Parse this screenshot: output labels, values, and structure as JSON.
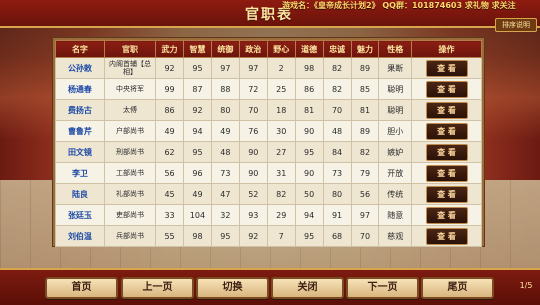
{
  "header": {
    "title": "官职表",
    "notice": "游戏名：《皇帝成长计划2》 QQ群：101874603 求礼物 求关注",
    "rules_label": "排序说明"
  },
  "table": {
    "columns": [
      "名字",
      "官职",
      "武力",
      "智慧",
      "统御",
      "政治",
      "野心",
      "道德",
      "忠诚",
      "魅力",
      "性格",
      "操作"
    ],
    "rows": [
      {
        "name": "公孙敕",
        "post": "内阁首辅【总相】",
        "wuli": "92",
        "zhihui": "95",
        "tongyu": "97",
        "zhengzhi": "97",
        "yexin": "2",
        "daode": "98",
        "zhongcheng": "82",
        "meili": "89",
        "xingge": "果断",
        "action": "查 看"
      },
      {
        "name": "杨通春",
        "post": "中央将军",
        "wuli": "99",
        "zhihui": "87",
        "tongyu": "88",
        "zhengzhi": "72",
        "yexin": "25",
        "daode": "86",
        "zhongcheng": "82",
        "meili": "85",
        "xingge": "聪明",
        "action": "查 看"
      },
      {
        "name": "费扬古",
        "post": "太傅",
        "wuli": "86",
        "zhihui": "92",
        "tongyu": "80",
        "zhengzhi": "70",
        "yexin": "18",
        "daode": "81",
        "zhongcheng": "70",
        "meili": "81",
        "xingge": "聪明",
        "action": "查 看"
      },
      {
        "name": "曹鲁芹",
        "post": "户部尚书",
        "wuli": "49",
        "zhihui": "94",
        "tongyu": "49",
        "zhengzhi": "76",
        "yexin": "30",
        "daode": "90",
        "zhongcheng": "48",
        "meili": "89",
        "xingge": "胆小",
        "action": "查 看"
      },
      {
        "name": "田文镜",
        "post": "刑部尚书",
        "wuli": "62",
        "zhihui": "95",
        "tongyu": "48",
        "zhengzhi": "90",
        "yexin": "27",
        "daode": "95",
        "zhongcheng": "84",
        "meili": "82",
        "xingge": "嫉妒",
        "action": "查 看"
      },
      {
        "name": "李卫",
        "post": "工部尚书",
        "wuli": "56",
        "zhihui": "96",
        "tongyu": "73",
        "zhengzhi": "90",
        "yexin": "31",
        "daode": "90",
        "zhongcheng": "73",
        "meili": "79",
        "xingge": "开放",
        "action": "查 看"
      },
      {
        "name": "陆良",
        "post": "礼部尚书",
        "wuli": "45",
        "zhihui": "49",
        "tongyu": "47",
        "zhengzhi": "52",
        "yexin": "82",
        "daode": "50",
        "zhongcheng": "80",
        "meili": "56",
        "xingge": "传统",
        "action": "查 看"
      },
      {
        "name": "张廷玉",
        "post": "吏部尚书",
        "wuli": "33",
        "zhihui": "104",
        "tongyu": "32",
        "zhengzhi": "93",
        "yexin": "29",
        "daode": "94",
        "zhongcheng": "91",
        "meili": "97",
        "xingge": "随意",
        "action": "查 看"
      },
      {
        "name": "刘伯温",
        "post": "兵部尚书",
        "wuli": "55",
        "zhihui": "98",
        "tongyu": "95",
        "zhengzhi": "92",
        "yexin": "7",
        "daode": "95",
        "zhongcheng": "68",
        "meili": "70",
        "xingge": "慈观",
        "action": "查 看"
      }
    ]
  },
  "footer": {
    "first": "首页",
    "prev": "上一页",
    "toggle": "切换",
    "close": "关闭",
    "next": "下一页",
    "last": "尾页",
    "page": "1/5"
  }
}
